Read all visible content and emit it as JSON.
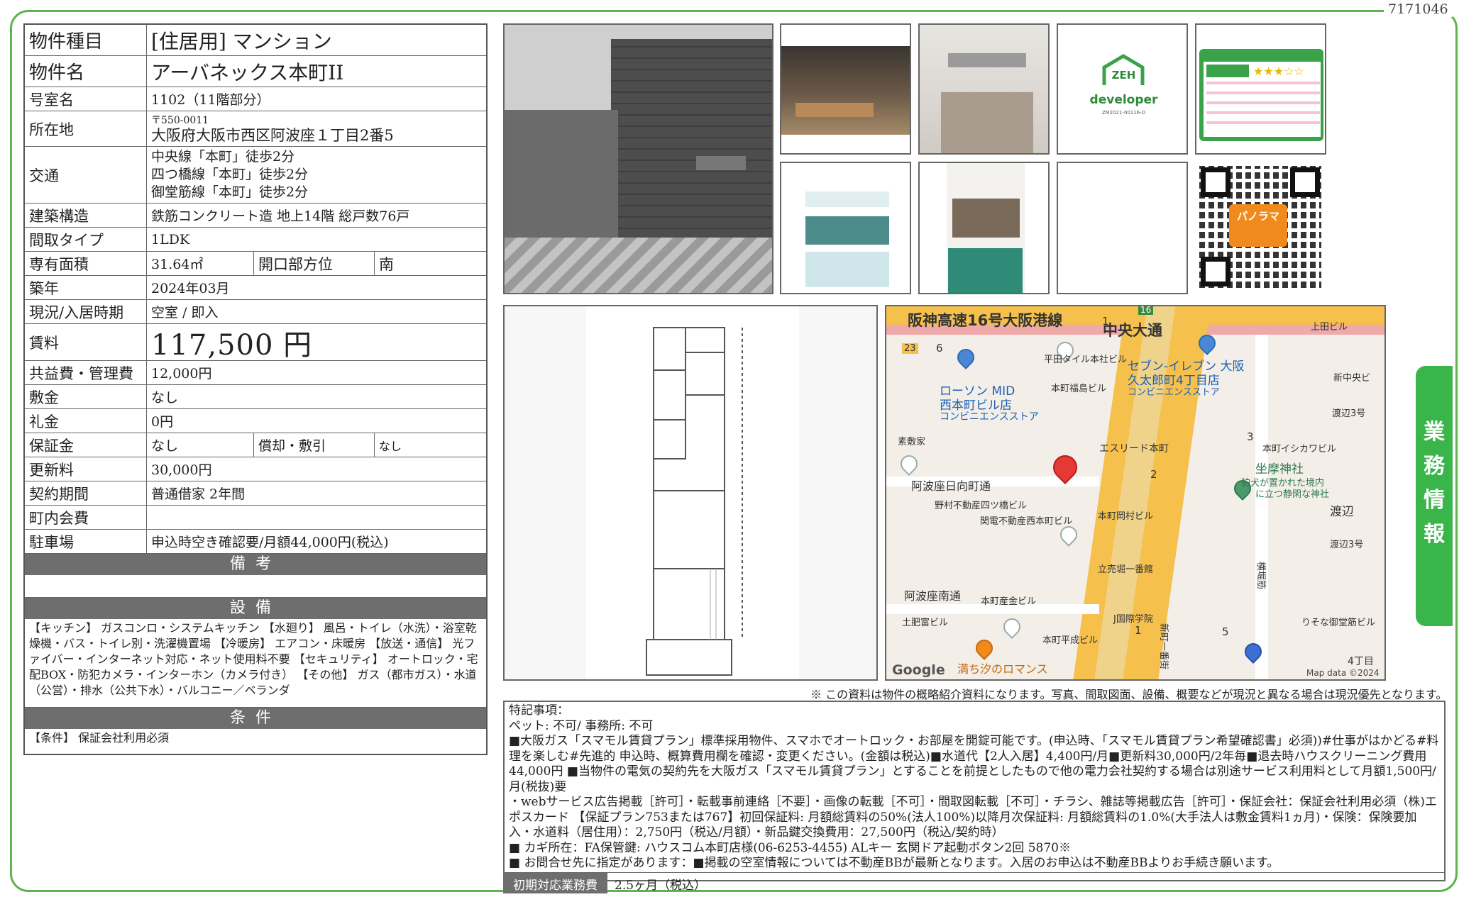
{
  "doc_id": "7171046",
  "spec": {
    "type_label": "物件種目",
    "type_value": "[住居用] マンション",
    "name_label": "物件名",
    "name_value": "アーバネックス本町II",
    "room_label": "号室名",
    "room_value": "1102（11階部分）",
    "addr_label": "所在地",
    "zip": "〒550-0011",
    "addr_value": "大阪府大阪市西区阿波座１丁目2番5",
    "traffic_label": "交通",
    "traffic": [
      "中央線「本町」徒歩2分",
      "四つ橋線「本町」徒歩2分",
      "御堂筋線「本町」徒歩2分"
    ],
    "structure_label": "建築構造",
    "structure_value": "鉄筋コンクリート造 地上14階 総戸数76戸",
    "layout_label": "間取タイプ",
    "layout_value": "1LDK",
    "area_label": "専有面積",
    "area_value": "31.64㎡",
    "direction_label": "開口部方位",
    "direction_value": "南",
    "built_label": "築年",
    "built_value": "2024年03月",
    "status_label": "現況/入居時期",
    "status_value": "空室 / 即入",
    "rent_label": "賃料",
    "rent_value": "117,500 円",
    "fee_label": "共益費・管理費",
    "fee_value": "12,000円",
    "deposit_label": "敷金",
    "deposit_value": "なし",
    "key_label": "礼金",
    "key_value": "0円",
    "guarantee_label": "保証金",
    "guarantee_value": "なし",
    "amort_label": "償却・敷引",
    "amort_value": "なし",
    "renewal_label": "更新料",
    "renewal_value": "30,000円",
    "contract_label": "契約期間",
    "contract_value": "普通借家 2年間",
    "community_label": "町内会費",
    "community_value": "",
    "parking_label": "駐車場",
    "parking_value": "申込時空き確認要/月額44,000円(税込)"
  },
  "sections": {
    "biko": "備考",
    "setsubi": "設備",
    "setsubi_text": "【キッチン】 ガスコンロ・システムキッチン 【水廻り】 風呂・トイレ（水洗）・浴室乾燥機・バス・トイレ別・洗濯機置場 【冷暖房】 エアコン・床暖房 【放送・通信】 光ファイバー・インターネット対応・ネット使用料不要 【セキュリティ】 オートロック・宅配BOX・防犯カメラ・インターホン（カメラ付き） 【その他】 ガス（都市ガス）・水道（公営）・排水（公共下水）・バルコニー／ベランダ",
    "joken": "条件",
    "joken_text": "【条件】 保証会社利用必須"
  },
  "photos": {
    "zeh_title": "ZEH",
    "zeh_sub": "developer",
    "zeh_code": "ZM2021-00116-D",
    "qr_label": "パノラマ"
  },
  "map": {
    "labels": [
      "阪神高速16号大阪港線",
      "中央大通",
      "ローソン MID",
      "西本町ビル店",
      "コンビニエンスストア",
      "セブン-イレブン 大阪",
      "久太郎町4丁目店",
      "コンビニエンスストア",
      "平田タイル本社ビル",
      "本町福島ビル",
      "上田ビル",
      "新中央ビ",
      "渡辺3号",
      "素敷家",
      "エスリード本町",
      "本町イシカワビル",
      "坐摩神社",
      "狛犬が置かれた境内",
      "に立つ静閑な神社",
      "阿波座日向町通",
      "野村不動産四ツ橋ビル",
      "関電不動産西本町ビル",
      "本町岡村ビル",
      "渡辺",
      "渡辺3号",
      "立売堀一番館",
      "阿波座南通",
      "本町産金ビル",
      "土肥富ビル",
      "J国際学院",
      "本町平成ビル",
      "りそな御堂筋ビル",
      "満ち汐のロマンス",
      "横堀筋",
      "新町一番街",
      "4丁目",
      "Google",
      "Map data ©2024",
      "16",
      "23",
      "1",
      "6",
      "3",
      "2",
      "5",
      "1"
    ]
  },
  "side_tab": "業務情報",
  "note": "※ この資料は物件の概略紹介資料になります。写真、間取図面、設備、概要などが現況と異なる場合は現況優先となります。",
  "remarks": [
    "特記事項：",
    "ペット: 不可/ 事務所: 不可",
    "■大阪ガス「スマモル賃貸プラン」標準採用物件、スマホでオートロック・お部屋を開錠可能です。(申込時、「スマモル賃貸プラン希望確認書」必須))#仕事がはかどる#料理を楽しむ#先進的 申込時、概算費用欄を確認・変更ください。(金額は税込)■水道代【2人入居】4,400円/月■更新料30,000円/2年毎■退去時ハウスクリーニング費用44,000円 ■当物件の電気の契約先を大阪ガス「スマモル賃貸プラン」とすることを前提としたもので他の電力会社契約する場合は別途サービス利用料として月額1,500円/月(税抜)要",
    "・webサービス広告掲載［許可］・転載事前連絡［不要］・画像の転載［不可］・間取図転載［不可］・チラシ、雑誌等掲載広告［許可］・保証会社：保証会社利用必須（株)エポスカード 【保証プラン753または767】初回保証料: 月額総賃料の50%(法人100%)以降月次保証料: 月額総賃料の1.0%(大手法人は敷金賃料1ヵ月)・保険：保険要加入・水道料（居住用）：2,750円（税込/月額）・新品鍵交換費用：27,500円（税込/契約時）",
    "■ カギ所在：FA保管鍵: ハウスコム本町店様(06-6253-4455) ALキー 玄関ドア起動ボタン2回 5870※",
    "■ お問合せ先に指定があります：■掲載の空室情報については不動産BBが最新となります。入居のお申込は不動産BBよりお手続き願います。"
  ],
  "initial_label": "初期対応業務費",
  "initial_value": "2.5ヶ月（税込）",
  "colors": {
    "frame": "#5bb54a",
    "tab": "#39b54a",
    "section": "#6e6e6e"
  }
}
